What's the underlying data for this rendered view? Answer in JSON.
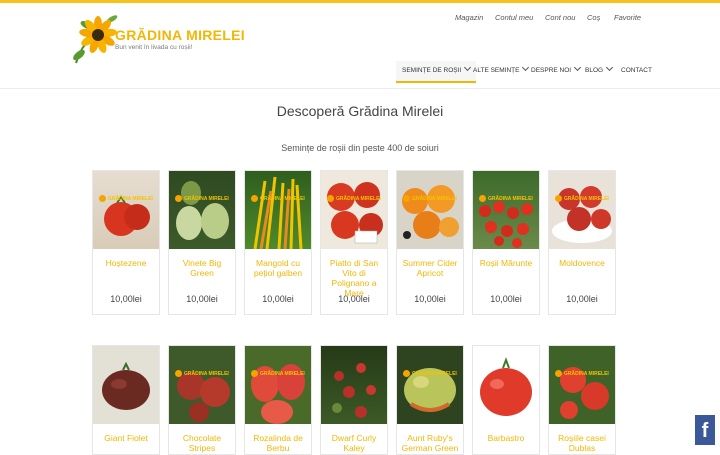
{
  "brand": {
    "title": "GRĂDINA MIRELEI",
    "tagline": "Bun venit în livada cu roșii!"
  },
  "util_nav": [
    "Magazin",
    "Contul meu",
    "Cont nou",
    "Coș",
    "Favorite"
  ],
  "main_nav": [
    {
      "label": "SEMINȚE DE ROȘII",
      "dropdown": true,
      "active": true
    },
    {
      "label": "ALTE SEMINȚE",
      "dropdown": true,
      "active": false
    },
    {
      "label": "DESPRE NOI",
      "dropdown": true,
      "active": false
    },
    {
      "label": "BLOG",
      "dropdown": true,
      "active": false
    },
    {
      "label": "CONTACT",
      "dropdown": false,
      "active": false
    }
  ],
  "page": {
    "title": "Descoperă Grădina Mirelei",
    "subtitle": "Semințe de roșii din peste 400 de soiuri"
  },
  "watermark": "GRĂDINA MIRELEI",
  "products_row1": [
    {
      "name": "Hoștezene",
      "price": "10,00lei"
    },
    {
      "name": "Vinete Big Green",
      "price": "10,00lei"
    },
    {
      "name": "Mangold cu pețiol galben",
      "price": "10,00lei"
    },
    {
      "name": "Piatto di San Vito di Polignano a Mare",
      "price": "10,00lei"
    },
    {
      "name": "Summer Cider Apricot",
      "price": "10,00lei"
    },
    {
      "name": "Roșii Mărunte",
      "price": "10,00lei"
    },
    {
      "name": "Moldovence",
      "price": "10,00lei"
    }
  ],
  "products_row2": [
    {
      "name": "Giant Fiolet"
    },
    {
      "name": "Chocolate Stripes"
    },
    {
      "name": "Rozalinda de Berbu"
    },
    {
      "name": "Dwarf Curly Kaley"
    },
    {
      "name": "Aunt Ruby's German Green"
    },
    {
      "name": "Barbastro"
    },
    {
      "name": "Roșiile casei Dublas"
    }
  ],
  "social": {
    "facebook_label": "f"
  },
  "colors": {
    "accent": "#f2b705",
    "topbar": "#f6c21a",
    "facebook": "#3b5998"
  }
}
